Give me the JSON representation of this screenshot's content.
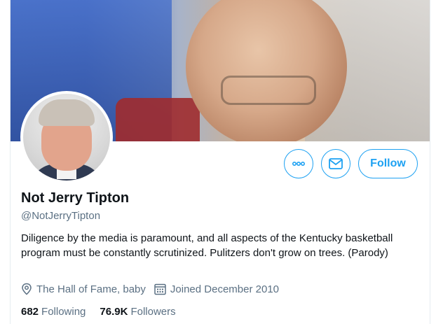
{
  "profile": {
    "name": "Not Jerry Tipton",
    "handle": "@NotJerryTipton",
    "bio": "Diligence by the media is paramount, and all aspects of the Kentucky basketball program must be constantly scrutinized. Pulitzers don't grow on trees. (Parody)",
    "location": "The Hall of Fame, baby",
    "joined": "Joined December 2010"
  },
  "actions": {
    "follow_label": "Follow",
    "more_icon": "more-icon",
    "message_icon": "mail-icon"
  },
  "stats": {
    "following_count": "682",
    "following_label": "Following",
    "followers_count": "76.9K",
    "followers_label": "Followers"
  },
  "colors": {
    "accent": "#1da1f2",
    "secondary_text": "#5b7083",
    "primary_text": "#0f1419"
  }
}
